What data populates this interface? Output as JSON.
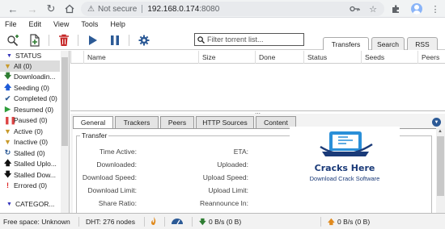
{
  "browser": {
    "security_label": "Not secure",
    "url_host": "192.168.0.174",
    "url_port": ":8080"
  },
  "menu": [
    "File",
    "Edit",
    "View",
    "Tools",
    "Help"
  ],
  "toolbar": {
    "search_placeholder": "Filter torrent list...",
    "view_tabs": [
      "Transfers",
      "Search",
      "RSS"
    ]
  },
  "sidebar": {
    "status_header": "STATUS",
    "items": [
      {
        "label": "All (0)",
        "icon": "filter-icon"
      },
      {
        "label": "Downloadin...",
        "icon": "download-arrow-icon"
      },
      {
        "label": "Seeding (0)",
        "icon": "upload-arrow-icon"
      },
      {
        "label": "Completed (0)",
        "icon": "checkmark-icon"
      },
      {
        "label": "Resumed (0)",
        "icon": "play-icon"
      },
      {
        "label": "Paused (0)",
        "icon": "pause-icon"
      },
      {
        "label": "Active (0)",
        "icon": "filter-icon"
      },
      {
        "label": "Inactive (0)",
        "icon": "filter-icon"
      },
      {
        "label": "Stalled (0)",
        "icon": "refresh-icon"
      },
      {
        "label": "Stalled Uplo...",
        "icon": "upload-arrow-icon"
      },
      {
        "label": "Stalled Dow...",
        "icon": "download-arrow-icon"
      },
      {
        "label": "Errored (0)",
        "icon": "exclamation-icon"
      }
    ],
    "category_header": "CATEGOR..."
  },
  "list": {
    "columns": [
      "Name",
      "Size",
      "Done",
      "Status",
      "Seeds",
      "Peers"
    ]
  },
  "details": {
    "tabs": [
      "General",
      "Trackers",
      "Peers",
      "HTTP Sources",
      "Content"
    ],
    "section_title": "Transfer",
    "left_labels": [
      "Time Active:",
      "Downloaded:",
      "Download Speed:",
      "Download Limit:",
      "Share Ratio:"
    ],
    "right_labels": [
      "ETA:",
      "Uploaded:",
      "Upload Speed:",
      "Upload Limit:",
      "Reannounce In:"
    ]
  },
  "logo": {
    "title": "Cracks Here",
    "subtitle": "Download Crack Software"
  },
  "status_bar": {
    "free_space": "Free space: Unknown",
    "dht": "DHT: 276 nodes",
    "download": "0 B/s (0 B)",
    "upload": "0 B/s (0 B)"
  },
  "colors": {
    "accent": "#2c5a96",
    "download_green": "#2e7d32",
    "upload_blue": "#1e5bd8",
    "delete_red": "#c62828"
  }
}
